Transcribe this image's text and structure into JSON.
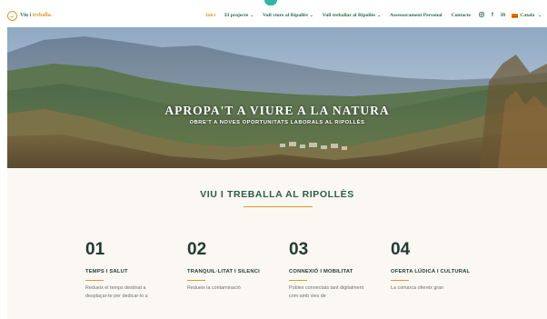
{
  "brand": {
    "name_part1": "Viu i ",
    "name_part2": "treballa."
  },
  "nav": {
    "items": [
      {
        "label": "Inici",
        "dropdown": false,
        "active": true
      },
      {
        "label": "El projecte",
        "dropdown": true,
        "active": false
      },
      {
        "label": "Vull viure al Ripollès",
        "dropdown": true,
        "active": false
      },
      {
        "label": "Vull treballar al Ripollès",
        "dropdown": true,
        "active": false
      },
      {
        "label": "Assessorament Personal",
        "dropdown": false,
        "active": false
      },
      {
        "label": "Contacte",
        "dropdown": false,
        "active": false
      }
    ],
    "social": [
      "instagram-icon",
      "facebook-icon",
      "linkedin-icon"
    ],
    "language": "Català"
  },
  "hero": {
    "title": "APROPA'T A VIURE A LA NATURA",
    "subtitle": "OBRE'T A NOVES OPORTUNITATS LABORALS AL RIPOLLÈS"
  },
  "section": {
    "title": "VIU I TREBALLA AL RIPOLLÈS"
  },
  "features": [
    {
      "number": "01",
      "title": "TEMPS I SALUT",
      "text": "Redueix el temps destinat a desplaçar-te per dedicar-lo a"
    },
    {
      "number": "02",
      "title": "TRANQUIL·LITAT I SILENCI",
      "text": "Redueix la contaminació"
    },
    {
      "number": "03",
      "title": "CONNEXIÓ I MOBILITAT",
      "text": "Pobles connectats tant digitalment com amb vies de"
    },
    {
      "number": "04",
      "title": "OFERTA LÚDICA I CULTURAL",
      "text": "La comarca ofereix gran"
    }
  ],
  "colors": {
    "accent": "#d79a2c",
    "brand_green": "#2d6a4f",
    "heading": "#1f3a33",
    "teal": "#2fb6a5",
    "section_bg": "#fbf8f3"
  }
}
